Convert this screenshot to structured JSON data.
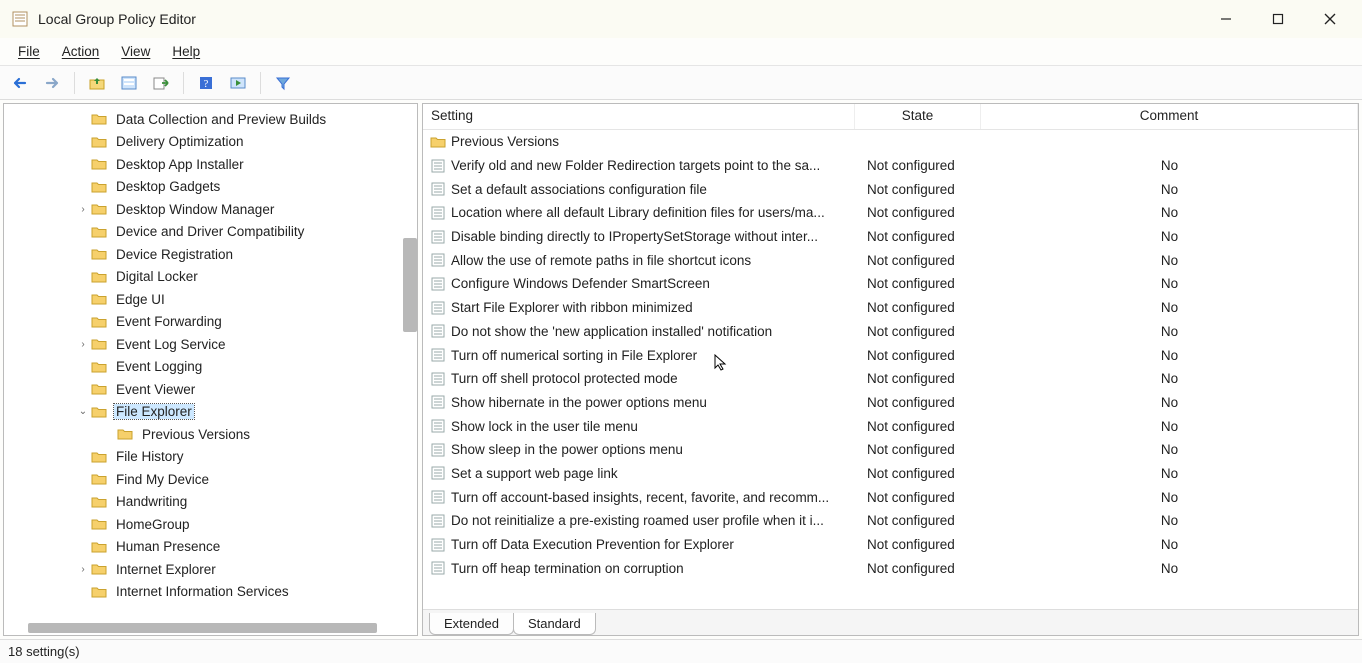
{
  "window": {
    "title": "Local Group Policy Editor"
  },
  "menu": {
    "file": "File",
    "action": "Action",
    "view": "View",
    "help": "Help"
  },
  "toolbar": {
    "back": "back-icon",
    "forward": "forward-icon",
    "up": "up-folder-icon",
    "props": "properties-icon",
    "export": "export-icon",
    "help": "help-icon",
    "run": "run-icon",
    "filter": "filter-icon"
  },
  "tree": {
    "items": [
      {
        "label": "Data Collection and Preview Builds",
        "exp": null
      },
      {
        "label": "Delivery Optimization",
        "exp": null
      },
      {
        "label": "Desktop App Installer",
        "exp": null
      },
      {
        "label": "Desktop Gadgets",
        "exp": null
      },
      {
        "label": "Desktop Window Manager",
        "exp": ">"
      },
      {
        "label": "Device and Driver Compatibility",
        "exp": null
      },
      {
        "label": "Device Registration",
        "exp": null
      },
      {
        "label": "Digital Locker",
        "exp": null
      },
      {
        "label": "Edge UI",
        "exp": null
      },
      {
        "label": "Event Forwarding",
        "exp": null
      },
      {
        "label": "Event Log Service",
        "exp": ">"
      },
      {
        "label": "Event Logging",
        "exp": null
      },
      {
        "label": "Event Viewer",
        "exp": null
      },
      {
        "label": "File Explorer",
        "exp": "v",
        "selected": true
      },
      {
        "label": "Previous Versions",
        "exp": null,
        "depth": 2
      },
      {
        "label": "File History",
        "exp": null
      },
      {
        "label": "Find My Device",
        "exp": null
      },
      {
        "label": "Handwriting",
        "exp": null
      },
      {
        "label": "HomeGroup",
        "exp": null
      },
      {
        "label": "Human Presence",
        "exp": null
      },
      {
        "label": "Internet Explorer",
        "exp": ">"
      },
      {
        "label": "Internet Information Services",
        "exp": null
      }
    ]
  },
  "list": {
    "columns": {
      "setting": "Setting",
      "state": "State",
      "comment": "Comment"
    },
    "rows": [
      {
        "type": "folder",
        "setting": "Previous Versions",
        "state": "",
        "comment": ""
      },
      {
        "type": "policy",
        "setting": "Verify old and new Folder Redirection targets point to the sa...",
        "state": "Not configured",
        "comment": "No"
      },
      {
        "type": "policy",
        "setting": "Set a default associations configuration file",
        "state": "Not configured",
        "comment": "No"
      },
      {
        "type": "policy",
        "setting": "Location where all default Library definition files for users/ma...",
        "state": "Not configured",
        "comment": "No"
      },
      {
        "type": "policy",
        "setting": "Disable binding directly to IPropertySetStorage without inter...",
        "state": "Not configured",
        "comment": "No"
      },
      {
        "type": "policy",
        "setting": "Allow the use of remote paths in file shortcut icons",
        "state": "Not configured",
        "comment": "No"
      },
      {
        "type": "policy",
        "setting": "Configure Windows Defender SmartScreen",
        "state": "Not configured",
        "comment": "No"
      },
      {
        "type": "policy",
        "setting": "Start File Explorer with ribbon minimized",
        "state": "Not configured",
        "comment": "No"
      },
      {
        "type": "policy",
        "setting": "Do not show the 'new application installed' notification",
        "state": "Not configured",
        "comment": "No"
      },
      {
        "type": "policy",
        "setting": "Turn off numerical sorting in File Explorer",
        "state": "Not configured",
        "comment": "No"
      },
      {
        "type": "policy",
        "setting": "Turn off shell protocol protected mode",
        "state": "Not configured",
        "comment": "No"
      },
      {
        "type": "policy",
        "setting": "Show hibernate in the power options menu",
        "state": "Not configured",
        "comment": "No"
      },
      {
        "type": "policy",
        "setting": "Show lock in the user tile menu",
        "state": "Not configured",
        "comment": "No"
      },
      {
        "type": "policy",
        "setting": "Show sleep in the power options menu",
        "state": "Not configured",
        "comment": "No"
      },
      {
        "type": "policy",
        "setting": "Set a support web page link",
        "state": "Not configured",
        "comment": "No"
      },
      {
        "type": "policy",
        "setting": "Turn off account-based insights, recent, favorite, and recomm...",
        "state": "Not configured",
        "comment": "No"
      },
      {
        "type": "policy",
        "setting": "Do not reinitialize a pre-existing roamed user profile when it i...",
        "state": "Not configured",
        "comment": "No"
      },
      {
        "type": "policy",
        "setting": "Turn off Data Execution Prevention for Explorer",
        "state": "Not configured",
        "comment": "No"
      },
      {
        "type": "policy",
        "setting": "Turn off heap termination on corruption",
        "state": "Not configured",
        "comment": "No"
      }
    ]
  },
  "tabs": {
    "extended": "Extended",
    "standard": "Standard",
    "active": "standard"
  },
  "status": {
    "text": "18 setting(s)"
  }
}
